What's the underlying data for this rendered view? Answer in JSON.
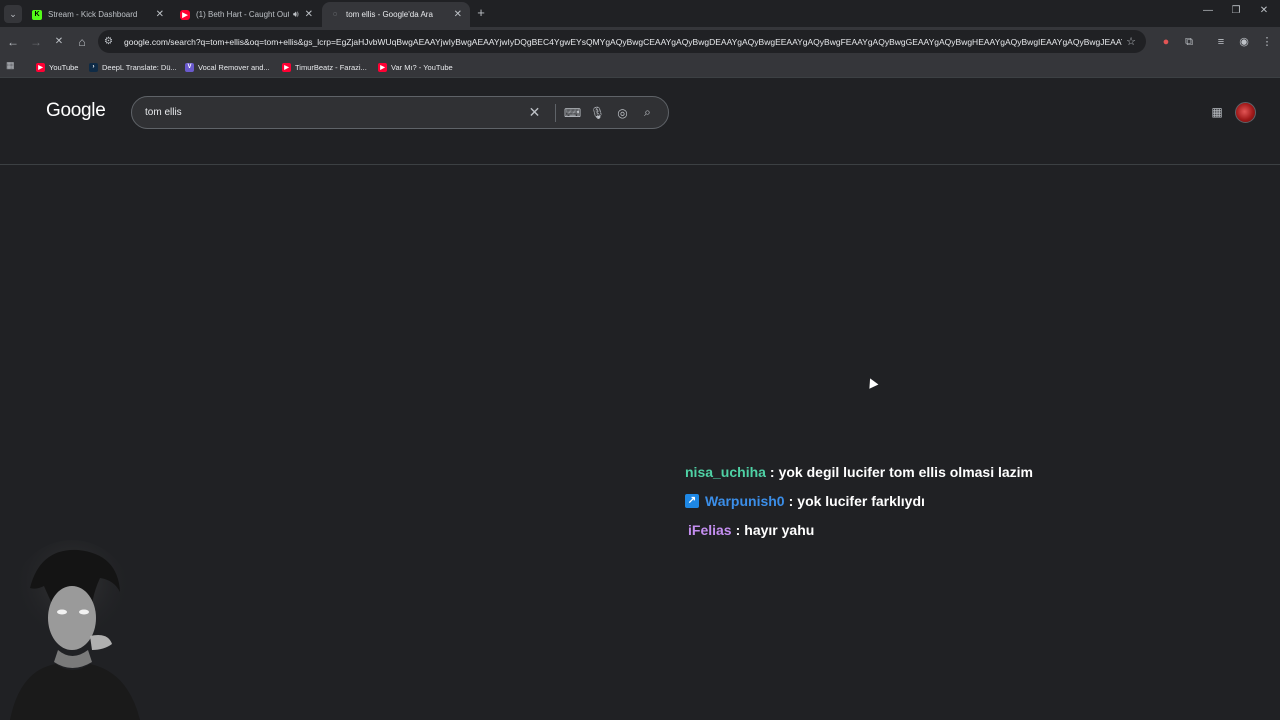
{
  "tabs": [
    {
      "title": "Stream - Kick Dashboard",
      "favicon": "K",
      "color": "#53fc18",
      "active": false
    },
    {
      "title": "(1) Beth Hart - Caught Out",
      "favicon": "▶",
      "color": "#ff0033",
      "active": false,
      "audio": true
    },
    {
      "title": "tom ellis - Google'da Ara",
      "favicon": "◌",
      "color": "#5f6368",
      "active": true
    }
  ],
  "toolbar": {
    "url": "google.com/search?q=tom+ellis&oq=tom+ellis&gs_lcrp=EgZjaHJvbWUqBwgAEAAYjwIyBwgAEAAYjwIyDQgBEC4YgwEYsQMYgAQyBwgCEAAYgAQyBwgDEAAYgAQyBwgEEAAYgAQyBwgFEAAYgAQyBwgGEAAYgAQyBwgHEAAYgAQyBwgIEAAYgAQyBwgJEAAYgAT..."
  },
  "bookmarks": [
    {
      "label": "YouTube",
      "favicon": "▶",
      "color": "#ff0033"
    },
    {
      "label": "DeepL Translate: Dü...",
      "favicon": "›",
      "color": "#0f2b46"
    },
    {
      "label": "Vocal Remover and...",
      "favicon": "V",
      "color": "#6a5acd"
    },
    {
      "label": "TimurBeatz - Farazi...",
      "favicon": "▶",
      "color": "#ff0033"
    },
    {
      "label": "Var Mı? - YouTube",
      "favicon": "▶",
      "color": "#ff0033"
    }
  ],
  "google": {
    "logo": "Google",
    "query": "tom ellis"
  },
  "chat": [
    {
      "user": "nisa_uchiha",
      "user_color": "#4fd1a5",
      "message": "yok degil lucifer tom ellis olmasi lazim",
      "badge": false
    },
    {
      "user": "Warpunish0",
      "user_color": "#3b8ee8",
      "message": "yok lucifer farklıydı",
      "badge": true
    },
    {
      "user": "iFelias",
      "user_color": "#c48ef0",
      "message": "hayır yahu",
      "badge": false
    }
  ],
  "colors": {
    "page_bg": "#202124",
    "chrome_bg": "#35363a"
  }
}
